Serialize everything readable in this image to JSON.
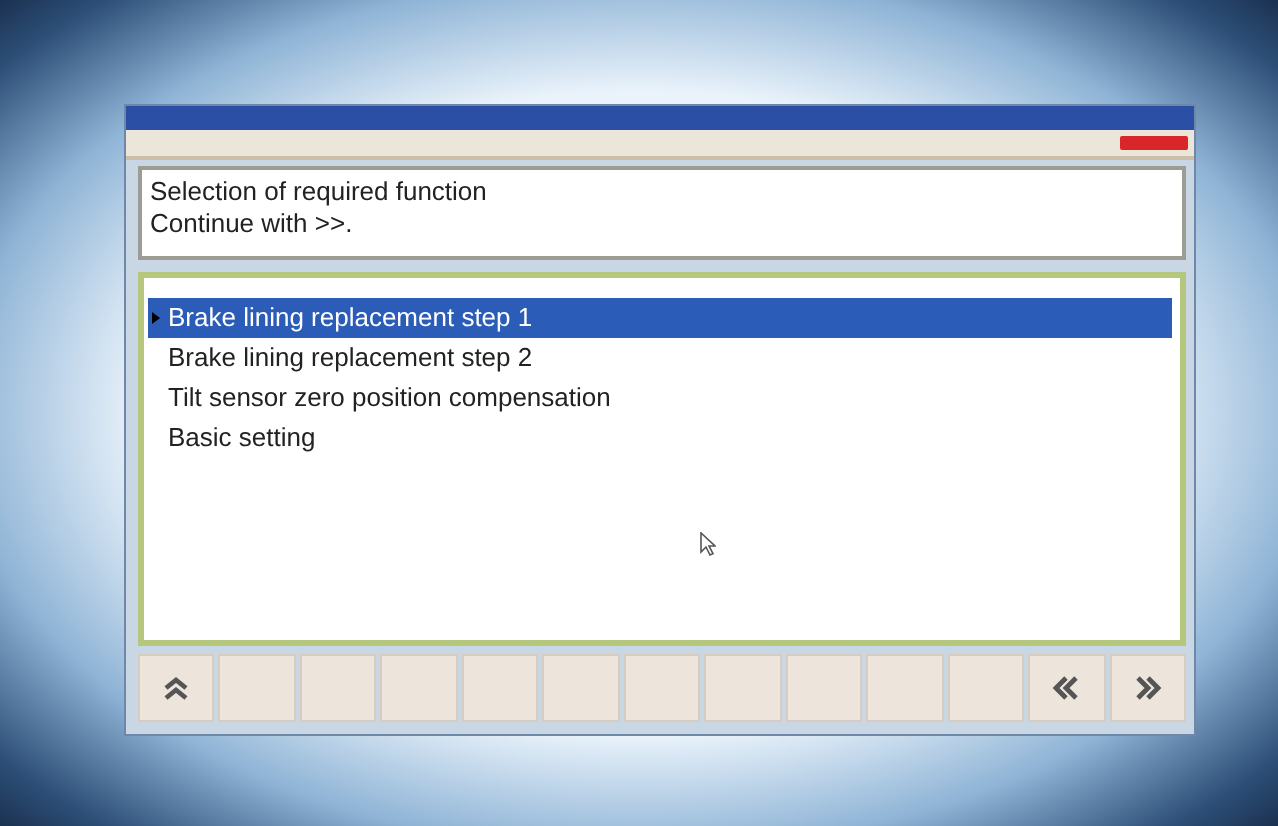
{
  "message": {
    "lines": [
      "Selection of required function",
      "Continue with >>."
    ]
  },
  "functions": [
    {
      "label": "Brake lining replacement step 1",
      "selected": true
    },
    {
      "label": "Brake lining replacement step 2",
      "selected": false
    },
    {
      "label": "Tilt sensor zero position compensation",
      "selected": false
    },
    {
      "label": "Basic setting",
      "selected": false
    }
  ],
  "buttons": [
    {
      "kind": "up"
    },
    {
      "kind": "empty"
    },
    {
      "kind": "empty"
    },
    {
      "kind": "empty"
    },
    {
      "kind": "empty"
    },
    {
      "kind": "empty"
    },
    {
      "kind": "empty"
    },
    {
      "kind": "empty"
    },
    {
      "kind": "empty"
    },
    {
      "kind": "empty"
    },
    {
      "kind": "empty"
    },
    {
      "kind": "back"
    },
    {
      "kind": "next"
    }
  ]
}
